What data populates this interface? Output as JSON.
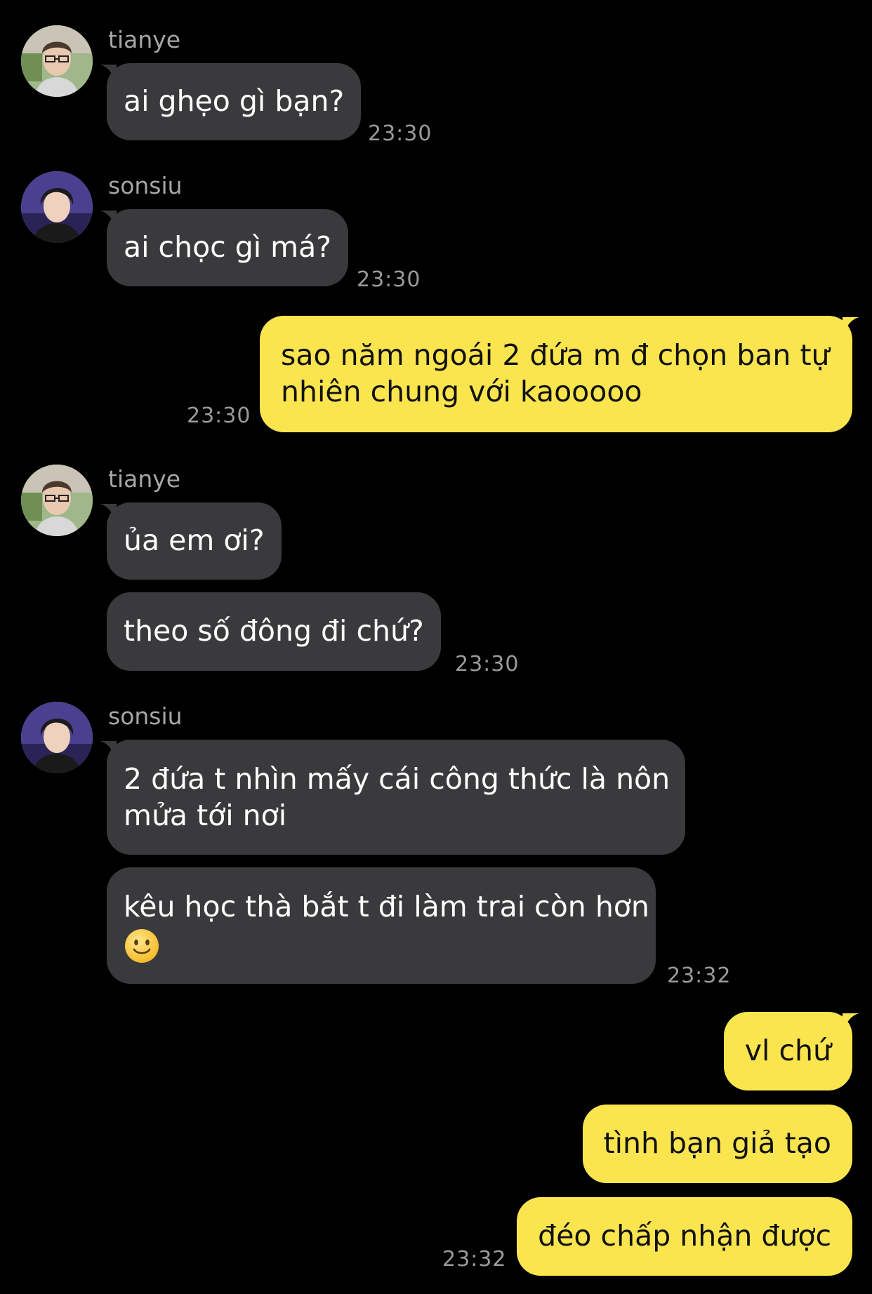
{
  "messages": [
    {
      "sender": "tianye",
      "text": "ai ghẹo gì bạn?",
      "time": "23:30"
    },
    {
      "sender": "sonsiu",
      "text": "ai chọc gì má?",
      "time": "23:30"
    },
    {
      "line1": "sao năm ngoái 2 đứa m đ chọn ban tự",
      "line2": "nhiên chung với kaooooo",
      "time": "23:30"
    },
    {
      "sender": "tianye",
      "text1": "ủa em ơi?",
      "text2": "theo số đông đi chứ?",
      "time": "23:30"
    },
    {
      "sender": "sonsiu",
      "line1": "2 đứa t nhìn mấy cái công thức là nôn",
      "line2": "mửa tới nơi",
      "line3": "kêu học thà bắt t đi làm trai còn hơn",
      "emoji": "slightly-smiling-face-icon",
      "time": "23:32"
    },
    {
      "text1": "vl chứ",
      "text2": "tình bạn giả tạo",
      "text3": "đéo chấp nhận được",
      "time": "23:32"
    }
  ],
  "colors": {
    "background": "#000000",
    "incoming_bubble": "#3a3a3c",
    "outgoing_bubble": "#fae54f",
    "timestamp": "#9a9a9a"
  }
}
